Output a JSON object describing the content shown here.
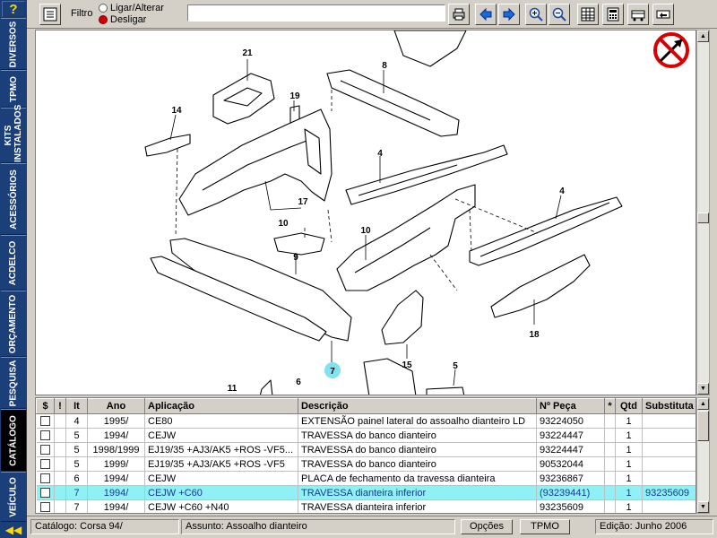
{
  "sidebar": {
    "help": "?",
    "tabs": [
      "DIVERSOS",
      "TPMO",
      "KITS INSTALADOS",
      "ACESSÓRIOS",
      "ACDELCO",
      "ORÇAMENTO",
      "PESQUISA",
      "CATÁLOGO",
      "VEÍCULO"
    ],
    "active_tab": "CATÁLOGO"
  },
  "toolbar": {
    "filter_label": "Filtro",
    "radio_on_label": "Ligar/Alterar",
    "radio_off_label": "Desligar",
    "filter_value": "",
    "icons": [
      "filter-settings-icon",
      "print-icon",
      "arrow-left-icon",
      "arrow-right-icon",
      "zoom-in-icon",
      "zoom-out-icon",
      "grid-icon",
      "calculator-icon",
      "cart-icon",
      "cart-remove-icon"
    ]
  },
  "diagram": {
    "callouts": [
      "21",
      "8",
      "19",
      "14",
      "4",
      "17",
      "10",
      "4",
      "10",
      "9",
      "18",
      "7",
      "15",
      "5",
      "11",
      "6"
    ],
    "highlighted_callout": "7",
    "no_pointer_icon": "no-arrow-icon"
  },
  "table": {
    "columns": [
      "$",
      "!",
      "It",
      "Ano",
      "Aplicação",
      "Descrição",
      "Nº Peça",
      "*",
      "Qtd",
      "Substituta"
    ],
    "rows": [
      {
        "it": "4",
        "ano": "1995/",
        "aplicacao": "CE80",
        "descricao": "EXTENSÃO painel lateral do assoalho dianteiro LD",
        "peca": "93224050",
        "star": "",
        "qtd": "1",
        "substituta": ""
      },
      {
        "it": "5",
        "ano": "1994/",
        "aplicacao": "CEJW",
        "descricao": "TRAVESSA do banco dianteiro",
        "peca": "93224447",
        "star": "",
        "qtd": "1",
        "substituta": ""
      },
      {
        "it": "5",
        "ano": "1998/1999",
        "aplicacao": "EJ19/35 +AJ3/AK5 +ROS -VF5...",
        "descricao": "TRAVESSA do banco dianteiro",
        "peca": "93224447",
        "star": "",
        "qtd": "1",
        "substituta": ""
      },
      {
        "it": "5",
        "ano": "1999/",
        "aplicacao": "EJ19/35 +AJ3/AK5 +ROS -VF5",
        "descricao": "TRAVESSA do banco dianteiro",
        "peca": "90532044",
        "star": "",
        "qtd": "1",
        "substituta": ""
      },
      {
        "it": "6",
        "ano": "1994/",
        "aplicacao": "CEJW",
        "descricao": "PLACA de fechamento da travessa dianteira",
        "peca": "93236867",
        "star": "",
        "qtd": "1",
        "substituta": ""
      },
      {
        "it": "7",
        "ano": "1994/",
        "aplicacao": "CEJW +C60",
        "descricao": "TRAVESSA dianteira inferior",
        "peca": "(93239441)",
        "star": "",
        "qtd": "1",
        "substituta": "93235609"
      },
      {
        "it": "7",
        "ano": "1994/",
        "aplicacao": "CEJW +C60 +N40",
        "descricao": "TRAVESSA dianteira inferior",
        "peca": "93235609",
        "star": "",
        "qtd": "1",
        "substituta": ""
      }
    ],
    "selected_index": 5
  },
  "status": {
    "catalogo": "Catálogo: Corsa 94/",
    "assunto": "Assunto: Assoalho dianteiro",
    "opcoes": "Opções",
    "tpmo": "TPMO",
    "edicao": "Edição: Junho 2006"
  },
  "colors": {
    "sidebar_bg": "#1b3f78",
    "highlight_row": "#8ff0f5",
    "highlight_callout": "#7fe3f0"
  }
}
